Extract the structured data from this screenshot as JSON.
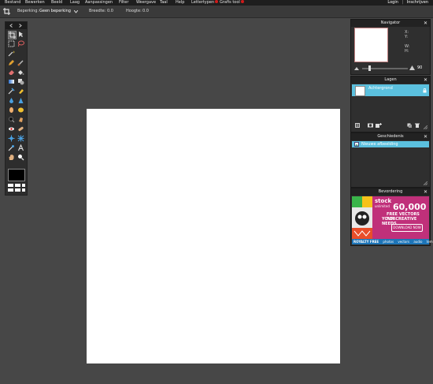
{
  "menu": {
    "items": [
      "Bestand",
      "Bewerken",
      "Beeld",
      "Laag",
      "Aanpassingen",
      "Filter",
      "Weergave",
      "Taal",
      "Help",
      "Lettertypen",
      "Grafis tool"
    ],
    "login": "Login",
    "separator": "|",
    "register": "Inschrijven"
  },
  "options": {
    "crop_label": "Beperking:",
    "crop_value": "Geen beperking",
    "width_label": "Breedte:",
    "width_value": "0.0",
    "height_label": "Hoogte:",
    "height_value": "0.0"
  },
  "navigator": {
    "title": "Navigator",
    "x_label": "X:",
    "y_label": "Y:",
    "w_label": "W:",
    "h_label": "H:",
    "zoom": "90"
  },
  "layers": {
    "title": "Lagen",
    "items": [
      "Achtergrond"
    ]
  },
  "history": {
    "title": "Geschiedenis",
    "items": [
      "Nieuwe afbeelding"
    ]
  },
  "ad": {
    "title": "Bevordering",
    "brand": "stock",
    "brand_sub": "unlimited",
    "count": "60,000",
    "line1": "FREE VECTORS FOR",
    "line2": "YOUR CREATIVE NEEDS",
    "cta": "DOWNLOAD NOW",
    "footer_left": "ROYALTY FREE",
    "footer_items": [
      "photos",
      "vectors",
      "audio",
      "templates"
    ]
  },
  "colors": {
    "accent": "#5bc0de",
    "menubar": "#1e1e1e",
    "workspace": "#474747",
    "badge": "#d01a1a"
  }
}
